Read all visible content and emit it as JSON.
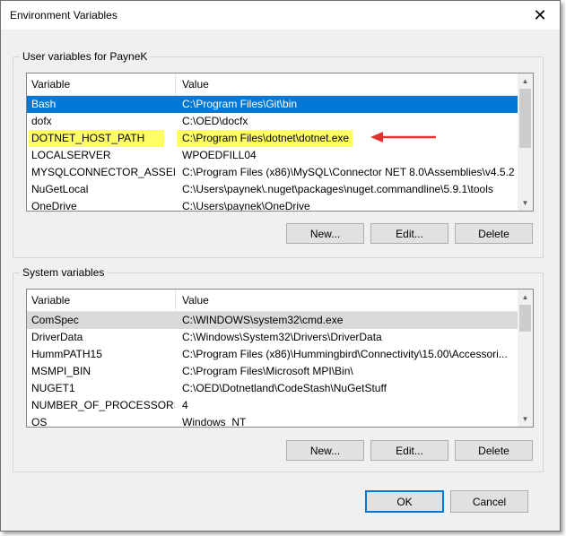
{
  "window": {
    "title": "Environment Variables",
    "close_icon": "close-icon"
  },
  "user_group": {
    "label": "User variables for PayneK",
    "columns": [
      "Variable",
      "Value"
    ],
    "rows": [
      {
        "variable": "Bash",
        "value": "C:\\Program Files\\Git\\bin",
        "state": "selected"
      },
      {
        "variable": "dofx",
        "value": "C:\\OED\\docfx"
      },
      {
        "variable": "DOTNET_HOST_PATH",
        "value": "C:\\Program Files\\dotnet\\dotnet.exe",
        "state": "highlighted"
      },
      {
        "variable": "LOCALSERVER",
        "value": "WPOEDFILL04"
      },
      {
        "variable": "MYSQLCONNECTOR_ASSEM...",
        "value": "C:\\Program Files (x86)\\MySQL\\Connector NET 8.0\\Assemblies\\v4.5.2"
      },
      {
        "variable": "NuGetLocal",
        "value": "C:\\Users\\paynek\\.nuget\\packages\\nuget.commandline\\5.9.1\\tools"
      },
      {
        "variable": "OneDrive",
        "value": "C:\\Users\\paynek\\OneDrive"
      }
    ],
    "buttons": {
      "new": "New...",
      "edit": "Edit...",
      "delete": "Delete"
    }
  },
  "system_group": {
    "label": "System variables",
    "columns": [
      "Variable",
      "Value"
    ],
    "rows": [
      {
        "variable": "ComSpec",
        "value": "C:\\WINDOWS\\system32\\cmd.exe",
        "state": "selected-inactive"
      },
      {
        "variable": "DriverData",
        "value": "C:\\Windows\\System32\\Drivers\\DriverData"
      },
      {
        "variable": "HummPATH15",
        "value": "C:\\Program Files (x86)\\Hummingbird\\Connectivity\\15.00\\Accessori..."
      },
      {
        "variable": "MSMPI_BIN",
        "value": "C:\\Program Files\\Microsoft MPI\\Bin\\"
      },
      {
        "variable": "NUGET1",
        "value": "C:\\OED\\Dotnetland\\CodeStash\\NuGetStuff"
      },
      {
        "variable": "NUMBER_OF_PROCESSORS",
        "value": "4"
      },
      {
        "variable": "OS",
        "value": "Windows_NT"
      }
    ],
    "buttons": {
      "new": "New...",
      "edit": "Edit...",
      "delete": "Delete"
    }
  },
  "footer": {
    "ok": "OK",
    "cancel": "Cancel"
  },
  "colors": {
    "selection": "#0078d7",
    "highlight": "#ffff66",
    "annotation_arrow": "#e03131"
  }
}
